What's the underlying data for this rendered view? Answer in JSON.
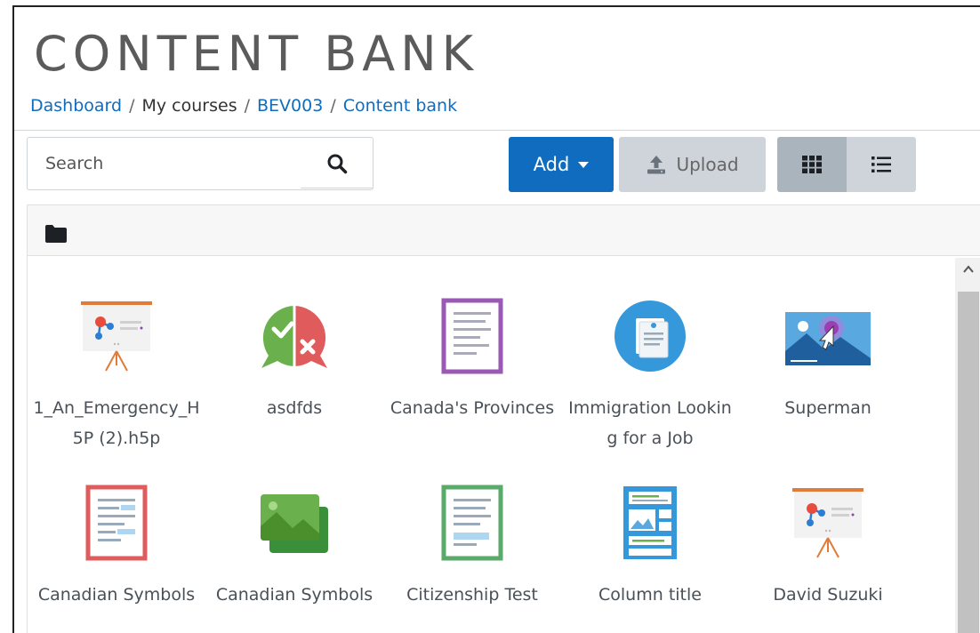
{
  "page": {
    "title": "CONTENT BANK"
  },
  "breadcrumb": {
    "items": [
      "Dashboard",
      "My courses",
      "BEV003",
      "Content bank"
    ],
    "separator": "/"
  },
  "search": {
    "placeholder": "Search"
  },
  "toolbar": {
    "add_label": "Add",
    "upload_label": "Upload"
  },
  "colors": {
    "accent": "#0f6cbf",
    "upload_bg": "#ced4da",
    "grid_active": "#aab4bd"
  },
  "items": [
    {
      "name": "1_An_Emergency_H5P (2).h5p",
      "icon": "presentation-icon"
    },
    {
      "name": "asdfds",
      "icon": "true-false-icon"
    },
    {
      "name": "Canada's Provinces",
      "icon": "document-purple-icon"
    },
    {
      "name": "Immigration Looking for a Job",
      "icon": "info-document-icon"
    },
    {
      "name": "Superman",
      "icon": "interactive-video-icon"
    },
    {
      "name": "Canadian Symbols",
      "icon": "document-red-icon"
    },
    {
      "name": "Canadian Symbols",
      "icon": "image-cards-icon"
    },
    {
      "name": "Citizenship Test",
      "icon": "document-green-icon"
    },
    {
      "name": "Column title",
      "icon": "column-layout-icon"
    },
    {
      "name": "David Suzuki",
      "icon": "presentation-icon"
    }
  ]
}
